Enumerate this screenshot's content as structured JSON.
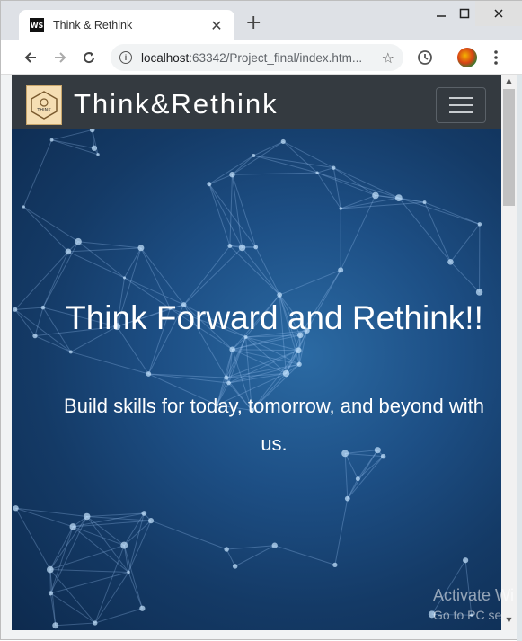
{
  "browser": {
    "tab_title": "Think & Rethink",
    "tab_favicon": "WS",
    "new_tab_label": "+",
    "url_host": "localhost",
    "url_rest": ":63342/Project_final/index.htm..."
  },
  "icons": {
    "back": "arrow-left-icon",
    "forward": "arrow-right-icon",
    "reload": "reload-icon",
    "info": "info-icon",
    "star": "star-icon",
    "history": "clock-icon",
    "menu": "kebab-menu-icon"
  },
  "site": {
    "brand": "Think&Rethink",
    "logo_text": "THINK",
    "hero_title": "Think Forward and Rethink!!",
    "hero_subtitle": "Build skills for today, tomorrow, and beyond with us."
  },
  "os": {
    "watermark_line1": "Activate Wi",
    "watermark_line2": "Go to PC se"
  },
  "colors": {
    "navbar": "#343a40",
    "hero_bg": "#1d4f85",
    "text": "#ffffff"
  }
}
